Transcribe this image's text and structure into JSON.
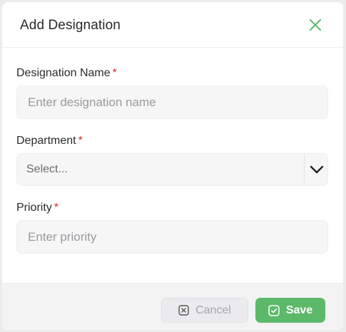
{
  "dialog": {
    "title": "Add Designation",
    "accent_color": "#5db96a"
  },
  "form": {
    "designation_name": {
      "label": "Designation Name",
      "required_mark": "*",
      "placeholder": "Enter designation name",
      "value": ""
    },
    "department": {
      "label": "Department",
      "required_mark": "*",
      "selected": "Select..."
    },
    "priority": {
      "label": "Priority",
      "required_mark": "*",
      "placeholder": "Enter priority",
      "value": ""
    }
  },
  "footer": {
    "cancel_label": "Cancel",
    "save_label": "Save"
  },
  "icons": {
    "close": "close-icon",
    "dropdown": "chevron-down-icon",
    "cancel": "x-square-icon",
    "save": "check-square-icon"
  }
}
